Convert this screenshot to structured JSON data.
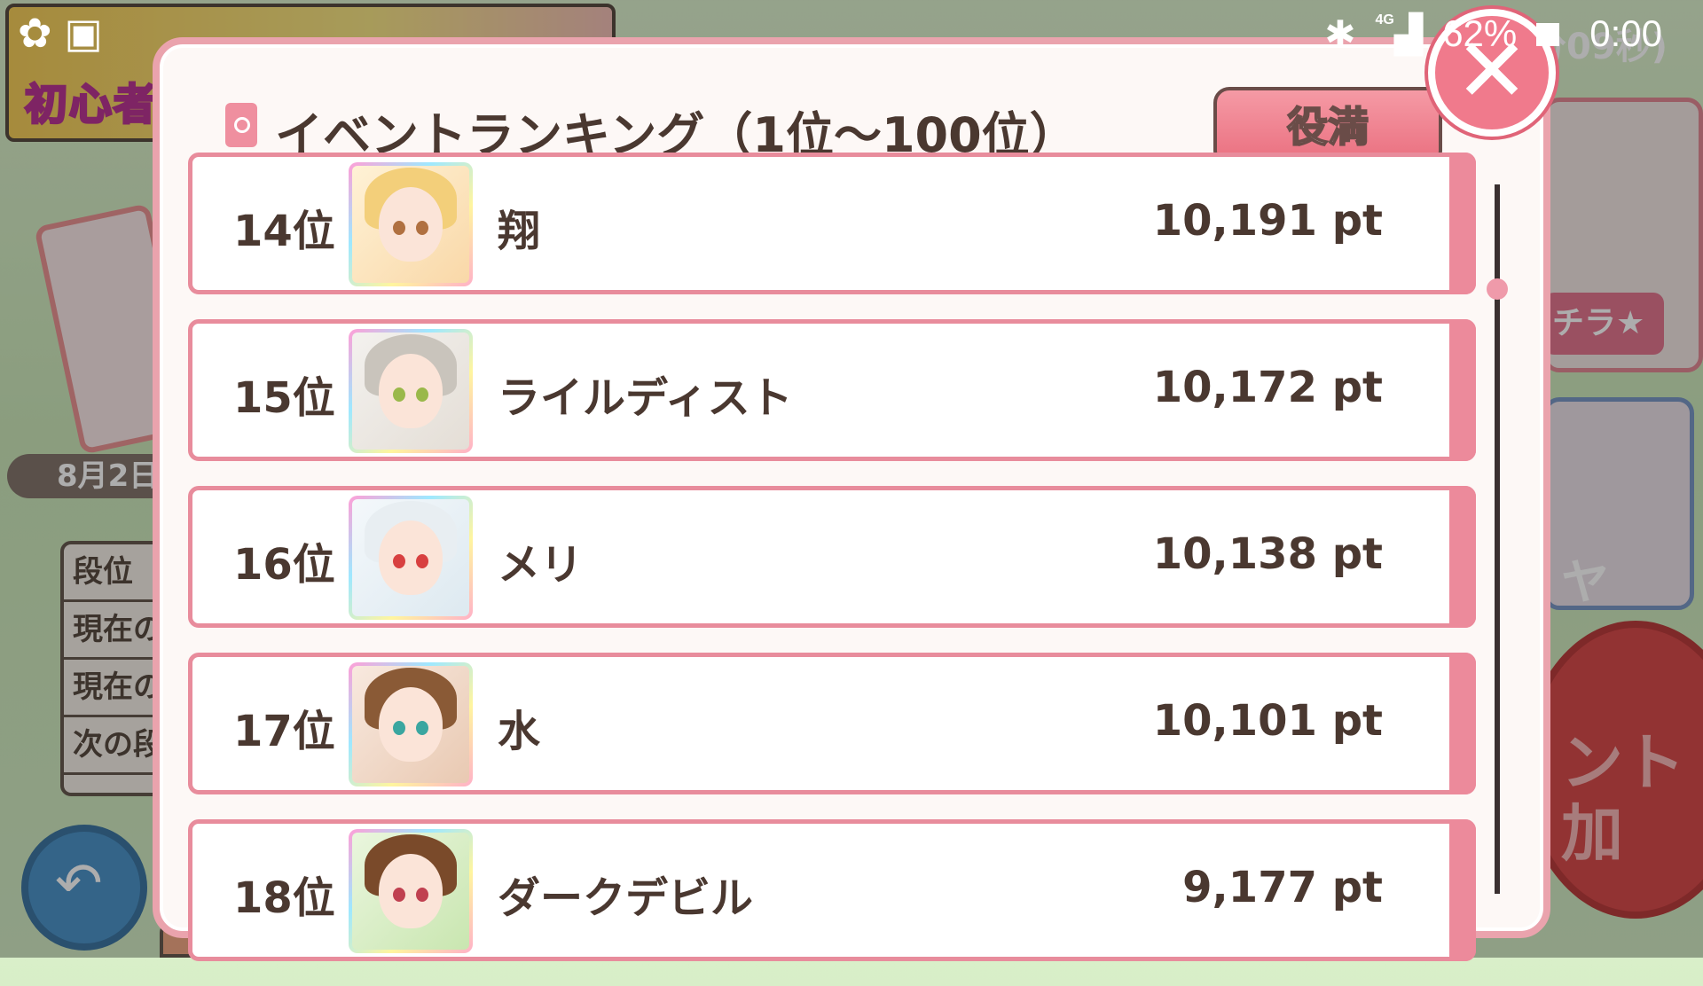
{
  "status_bar": {
    "network": "4G",
    "battery": "62%",
    "time": "0:00"
  },
  "background": {
    "banner_text": "初心者",
    "timer_text": "分09秒)",
    "date_text": "8月2日",
    "left_panel": [
      "段位",
      "現在の",
      "現在の",
      "次の段"
    ],
    "right_tag": "チラ★",
    "right_card_text": "ヤ",
    "stamp_text": "ント\n加"
  },
  "modal": {
    "title": "イベントランキング（1位～100位）",
    "yakuman_button": "役満",
    "close_icon": "✕",
    "rows": [
      {
        "rank": "14位",
        "name": "翔",
        "points": "10,191 pt",
        "hair": "#f3cf7a",
        "eye": "#b07040",
        "c1": "#fff2d6",
        "c2": "#f9d8a8"
      },
      {
        "rank": "15位",
        "name": "ライルディスト",
        "points": "10,172 pt",
        "hair": "#c9c4bc",
        "eye": "#9ab84a",
        "c1": "#f3f1ee",
        "c2": "#e4ded6"
      },
      {
        "rank": "16位",
        "name": "メリ",
        "points": "10,138 pt",
        "hair": "#e8eef2",
        "eye": "#d84040",
        "c1": "#f4f8fb",
        "c2": "#dde9f0"
      },
      {
        "rank": "17位",
        "name": "水",
        "points": "10,101 pt",
        "hair": "#8a5a36",
        "eye": "#3aa6a0",
        "c1": "#f8e9df",
        "c2": "#e9c9b2"
      },
      {
        "rank": "18位",
        "name": "ダークデビル",
        "points": "9,177 pt",
        "hair": "#7a4a2a",
        "eye": "#c04050",
        "c1": "#eaf6de",
        "c2": "#c9e6b0"
      }
    ]
  }
}
